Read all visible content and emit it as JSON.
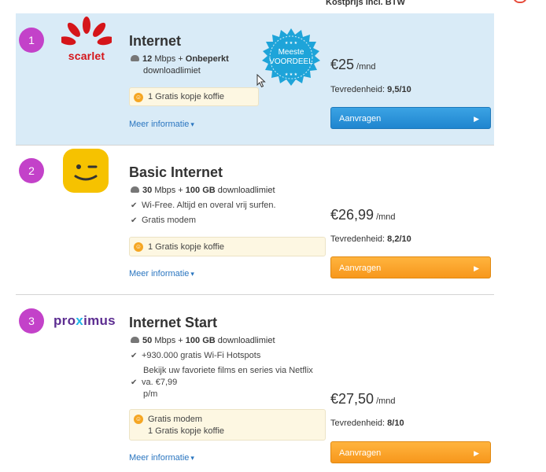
{
  "header": {
    "price_column": "Kostprijs incl. BTW"
  },
  "offers": [
    {
      "rank": "1",
      "provider_logo": "scarlet",
      "logo_text": "scarlet",
      "title": "Internet",
      "speed": "12",
      "speed_unit": "Mbps",
      "plus": "+",
      "limit": "Onbeperkt",
      "limit_suffix": "downloadlimiet",
      "features": [],
      "extras": [
        "1 Gratis kopje koffie"
      ],
      "more": "Meer informatie",
      "price": "€25",
      "per": "/mnd",
      "rating_label": "Tevredenheid:",
      "rating": "9,5/10",
      "cta": "Aanvragen",
      "badge": {
        "line1": "Meeste",
        "line2": "VOORDEEL"
      }
    },
    {
      "rank": "2",
      "provider_logo": "telenet",
      "title": "Basic Internet",
      "speed": "30",
      "speed_unit": "Mbps",
      "plus": "+",
      "limit": "100 GB",
      "limit_suffix": "downloadlimiet",
      "features": [
        "Wi-Free. Altijd en overal vrij surfen.",
        "Gratis modem"
      ],
      "extras": [
        "1 Gratis kopje koffie"
      ],
      "more": "Meer informatie",
      "price": "€26,99",
      "per": "/mnd",
      "rating_label": "Tevredenheid:",
      "rating": "8,2/10",
      "cta": "Aanvragen"
    },
    {
      "rank": "3",
      "provider_logo": "proximus",
      "logo_text": {
        "a": "pro",
        "x": "x",
        "b": "imus"
      },
      "title": "Internet Start",
      "speed": "50",
      "speed_unit": "Mbps",
      "plus": "+",
      "limit": "100 GB",
      "limit_suffix": "downloadlimiet",
      "features": [
        "+930.000 gratis Wi-Fi Hotspots"
      ],
      "netflix": {
        "l1": "Bekijk uw favoriete films en series via Netflix",
        "l2": "va. €7,99",
        "l3": "p/m"
      },
      "extras": [
        "Gratis modem",
        "1 Gratis kopje koffie"
      ],
      "more": "Meer informatie",
      "price": "€27,50",
      "per": "/mnd",
      "rating_label": "Tevredenheid:",
      "rating": "8/10",
      "cta": "Aanvragen"
    }
  ],
  "colors": {
    "rank_badge": "#c342c9",
    "highlight_row": "#d9ebf7",
    "cta_blue": "#1f85cf",
    "cta_orange": "#f7971c",
    "link": "#2b76c0"
  },
  "icons": {
    "more_chevron": "chevron-down-icon",
    "cta_arrow": "arrow-right-icon",
    "speed": "wifi-icon",
    "feature": "check-icon",
    "extra": "coffee-coin-icon"
  }
}
